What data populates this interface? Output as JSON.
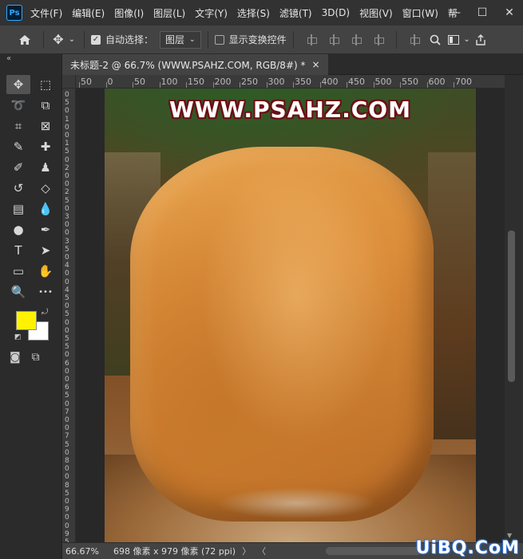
{
  "app": {
    "logo_text": "Ps"
  },
  "menu": {
    "items": [
      "文件(F)",
      "编辑(E)",
      "图像(I)",
      "图层(L)",
      "文字(Y)",
      "选择(S)",
      "滤镜(T)",
      "3D(D)",
      "视图(V)",
      "窗口(W)",
      "帮"
    ]
  },
  "window_controls": {
    "minimize": "—",
    "maximize": "☐",
    "close": "✕"
  },
  "options_bar": {
    "auto_select_label": "自动选择：",
    "auto_select_checked": true,
    "auto_select_target": "图层",
    "show_transform_label": "显示变换控件",
    "show_transform_checked": false
  },
  "toolbar": {
    "collapse_glyph": "«",
    "foreground_color": "#fff200",
    "background_color": "#ffffff",
    "tools": [
      {
        "name": "move-tool-icon",
        "glyph": "✥",
        "active": true
      },
      {
        "name": "marquee-tool-icon",
        "glyph": "⬚",
        "active": false
      },
      {
        "name": "lasso-tool-icon",
        "glyph": "➰",
        "active": false
      },
      {
        "name": "object-select-tool-icon",
        "glyph": "⧉",
        "active": false
      },
      {
        "name": "crop-tool-icon",
        "glyph": "⌗",
        "active": false
      },
      {
        "name": "frame-tool-icon",
        "glyph": "⊠",
        "active": false
      },
      {
        "name": "eyedropper-tool-icon",
        "glyph": "✎",
        "active": false
      },
      {
        "name": "healing-brush-tool-icon",
        "glyph": "✚",
        "active": false
      },
      {
        "name": "brush-tool-icon",
        "glyph": "✐",
        "active": false
      },
      {
        "name": "stamp-tool-icon",
        "glyph": "♟",
        "active": false
      },
      {
        "name": "history-brush-tool-icon",
        "glyph": "↺",
        "active": false
      },
      {
        "name": "eraser-tool-icon",
        "glyph": "◇",
        "active": false
      },
      {
        "name": "gradient-tool-icon",
        "glyph": "▤",
        "active": false
      },
      {
        "name": "blur-tool-icon",
        "glyph": "💧",
        "active": false
      },
      {
        "name": "dodge-tool-icon",
        "glyph": "●",
        "active": false
      },
      {
        "name": "pen-tool-icon",
        "glyph": "✒",
        "active": false
      },
      {
        "name": "type-tool-icon",
        "glyph": "T",
        "active": false
      },
      {
        "name": "path-select-tool-icon",
        "glyph": "➤",
        "active": false
      },
      {
        "name": "rectangle-tool-icon",
        "glyph": "▭",
        "active": false
      },
      {
        "name": "hand-tool-icon",
        "glyph": "✋",
        "active": false
      },
      {
        "name": "zoom-tool-icon",
        "glyph": "🔍",
        "active": false
      },
      {
        "name": "more-tools-icon",
        "glyph": "•••",
        "active": false
      }
    ]
  },
  "document": {
    "tab_title": "未标题-2 @ 66.7% (WWW.PSAHZ.COM, RGB/8#) *",
    "close_glyph": "×",
    "watermark_text": "WWW.PSAHZ.COM"
  },
  "ruler": {
    "h_labels": [
      "50",
      "0",
      "50",
      "100",
      "150",
      "200",
      "250",
      "300",
      "350",
      "400",
      "450",
      "500",
      "550",
      "600",
      "700"
    ],
    "v_labels": [
      "0",
      "5",
      "0",
      "1",
      "0",
      "0",
      "1",
      "5",
      "0",
      "2",
      "0",
      "0",
      "2",
      "5",
      "0",
      "3",
      "0",
      "0",
      "3",
      "5",
      "0",
      "4",
      "0",
      "0",
      "4",
      "5",
      "0",
      "5",
      "0",
      "0",
      "5",
      "5",
      "0",
      "6",
      "0",
      "0",
      "6",
      "5",
      "0",
      "7",
      "0",
      "0",
      "7",
      "5",
      "0",
      "8",
      "0",
      "0",
      "8",
      "5",
      "0",
      "9",
      "0",
      "0",
      "9",
      "5",
      "0"
    ]
  },
  "status": {
    "zoom": "66.67%",
    "doc_size": "698 像素 x 979 像素 (72 ppi)",
    "arrow": "〉",
    "left_arrow": "〈",
    "site_logo": "UiBQ.CoM"
  }
}
